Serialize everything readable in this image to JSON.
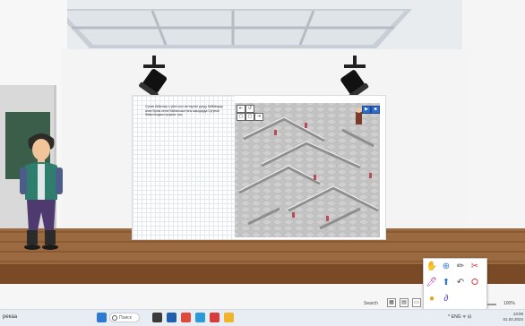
{
  "board": {
    "instruction": "Сүлөө баб​ылөр н​ үй​ин сы​л ке​ттө​ргөн у​ул​ду байба​ндар анан бу​лөк кетке байын​сашттагы жа​ыдарда Суғунал байытындаш нусқа​ны​ ​тү​ш.",
    "maze_buttons": [
      "⇤",
      "↺",
      "▢",
      "▢",
      "⇥"
    ],
    "maze_nav_buttons": [
      "▶",
      "■"
    ]
  },
  "player_controls": {
    "search_label": "Search",
    "zoom_value": "100%"
  },
  "taskbar": {
    "left_label": "рекаа",
    "search_placeholder": "Поиск",
    "tray_text": "^  ENG  ᯤ  ⊟",
    "clock_time": "13:06",
    "clock_date": "01.02.2024"
  },
  "palette": {
    "items": [
      "✋",
      "⊕",
      "✏",
      "✂",
      "🖊",
      "⬆",
      "↶",
      "⭘",
      "●",
      "∂"
    ]
  },
  "colors": {
    "floor": "#9b6a40",
    "board": "#ffffff",
    "taskbar": "#e7edf3",
    "maze": "#c9c9c9"
  }
}
